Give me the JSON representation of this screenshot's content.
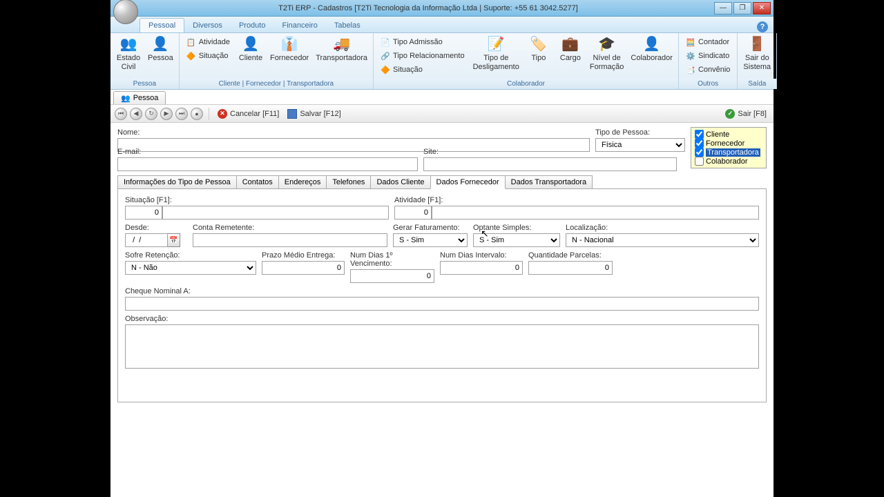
{
  "window": {
    "title": "T2Ti ERP - Cadastros [T2Ti Tecnologia da Informação Ltda | Suporte: +55 61 3042.5277]"
  },
  "menu": {
    "tabs": [
      "Pessoal",
      "Diversos",
      "Produto",
      "Financeiro",
      "Tabelas"
    ],
    "active": "Pessoal"
  },
  "ribbon": {
    "groups": [
      {
        "label": "Pessoa",
        "items": [
          {
            "name": "estado-civil",
            "label": "Estado\nCivil",
            "icon": "👥"
          },
          {
            "name": "pessoa",
            "label": "Pessoa",
            "icon": "👤"
          }
        ]
      },
      {
        "label": "Cliente | Fornecedor | Transportadora",
        "small": [
          {
            "name": "atividade",
            "label": "Atividade",
            "icon": "📋"
          },
          {
            "name": "situacao",
            "label": "Situação",
            "icon": "🔶"
          }
        ],
        "items": [
          {
            "name": "cliente",
            "label": "Cliente",
            "icon": "👤"
          },
          {
            "name": "fornecedor",
            "label": "Fornecedor",
            "icon": "👔"
          },
          {
            "name": "transportadora",
            "label": "Transportadora",
            "icon": "🚚"
          }
        ]
      },
      {
        "label": "Colaborador",
        "small": [
          {
            "name": "tipo-admissao",
            "label": "Tipo Admissão",
            "icon": "📄"
          },
          {
            "name": "tipo-relacionamento",
            "label": "Tipo Relacionamento",
            "icon": "🔗"
          },
          {
            "name": "situacao-colab",
            "label": "Situação",
            "icon": "🔶"
          }
        ],
        "items": [
          {
            "name": "tipo-desligamento",
            "label": "Tipo de\nDesligamento",
            "icon": "📝"
          },
          {
            "name": "tipo",
            "label": "Tipo",
            "icon": "🏷️"
          },
          {
            "name": "cargo",
            "label": "Cargo",
            "icon": "💼"
          },
          {
            "name": "nivel-formacao",
            "label": "Nível de\nFormação",
            "icon": "🎓"
          },
          {
            "name": "colaborador",
            "label": "Colaborador",
            "icon": "👤"
          }
        ]
      },
      {
        "label": "Outros",
        "small": [
          {
            "name": "contador",
            "label": "Contador",
            "icon": "🧮"
          },
          {
            "name": "sindicato",
            "label": "Sindicato",
            "icon": "⚙️"
          },
          {
            "name": "convenio",
            "label": "Convênio",
            "icon": "📑"
          }
        ]
      },
      {
        "label": "Saída",
        "items": [
          {
            "name": "sair-sistema",
            "label": "Sair do\nSistema",
            "icon": "🚪"
          }
        ]
      }
    ]
  },
  "doctab": {
    "label": "Pessoa"
  },
  "toolbar": {
    "cancel": "Cancelar [F11]",
    "save": "Salvar [F12]",
    "exit": "Sair [F8]"
  },
  "form": {
    "nome_label": "Nome:",
    "nome": "",
    "tipo_pessoa_label": "Tipo de Pessoa:",
    "tipo_pessoa": "Física",
    "email_label": "E-mail:",
    "email": "",
    "site_label": "Site:",
    "site": "",
    "options": {
      "cliente": {
        "label": "Cliente",
        "checked": true
      },
      "fornecedor": {
        "label": "Fornecedor",
        "checked": true
      },
      "transportadora": {
        "label": "Transportadora",
        "checked": true,
        "selected": true
      },
      "colaborador": {
        "label": "Colaborador",
        "checked": false
      }
    }
  },
  "subtabs": {
    "items": [
      "Informações do Tipo de Pessoa",
      "Contatos",
      "Endereços",
      "Telefones",
      "Dados Cliente",
      "Dados Fornecedor",
      "Dados Transportadora"
    ],
    "active": "Dados Fornecedor"
  },
  "fornecedor": {
    "situacao_label": "Situação [F1]:",
    "situacao_code": "0",
    "situacao_desc": "",
    "atividade_label": "Atividade [F1]:",
    "atividade_code": "0",
    "atividade_desc": "",
    "desde_label": "Desde:",
    "desde": "  /  /",
    "conta_remetente_label": "Conta Remetente:",
    "conta_remetente": "",
    "gerar_faturamento_label": "Gerar Faturamento:",
    "gerar_faturamento": "S - Sim",
    "optante_simples_label": "Optante Simples:",
    "optante_simples": "S - Sim",
    "localizacao_label": "Localização:",
    "localizacao": "N - Nacional",
    "sofre_retencao_label": "Sofre Retenção:",
    "sofre_retencao": "N - Não",
    "prazo_medio_label": "Prazo Médio Entrega:",
    "prazo_medio": "0",
    "num_dias_venc_label": "Num Dias 1º Vencimento:",
    "num_dias_venc": "0",
    "num_dias_interv_label": "Num Dias Intervalo:",
    "num_dias_interv": "0",
    "qtd_parcelas_label": "Quantidade Parcelas:",
    "qtd_parcelas": "0",
    "cheque_nominal_label": "Cheque Nominal A:",
    "cheque_nominal": "",
    "observacao_label": "Observação:",
    "observacao": ""
  }
}
